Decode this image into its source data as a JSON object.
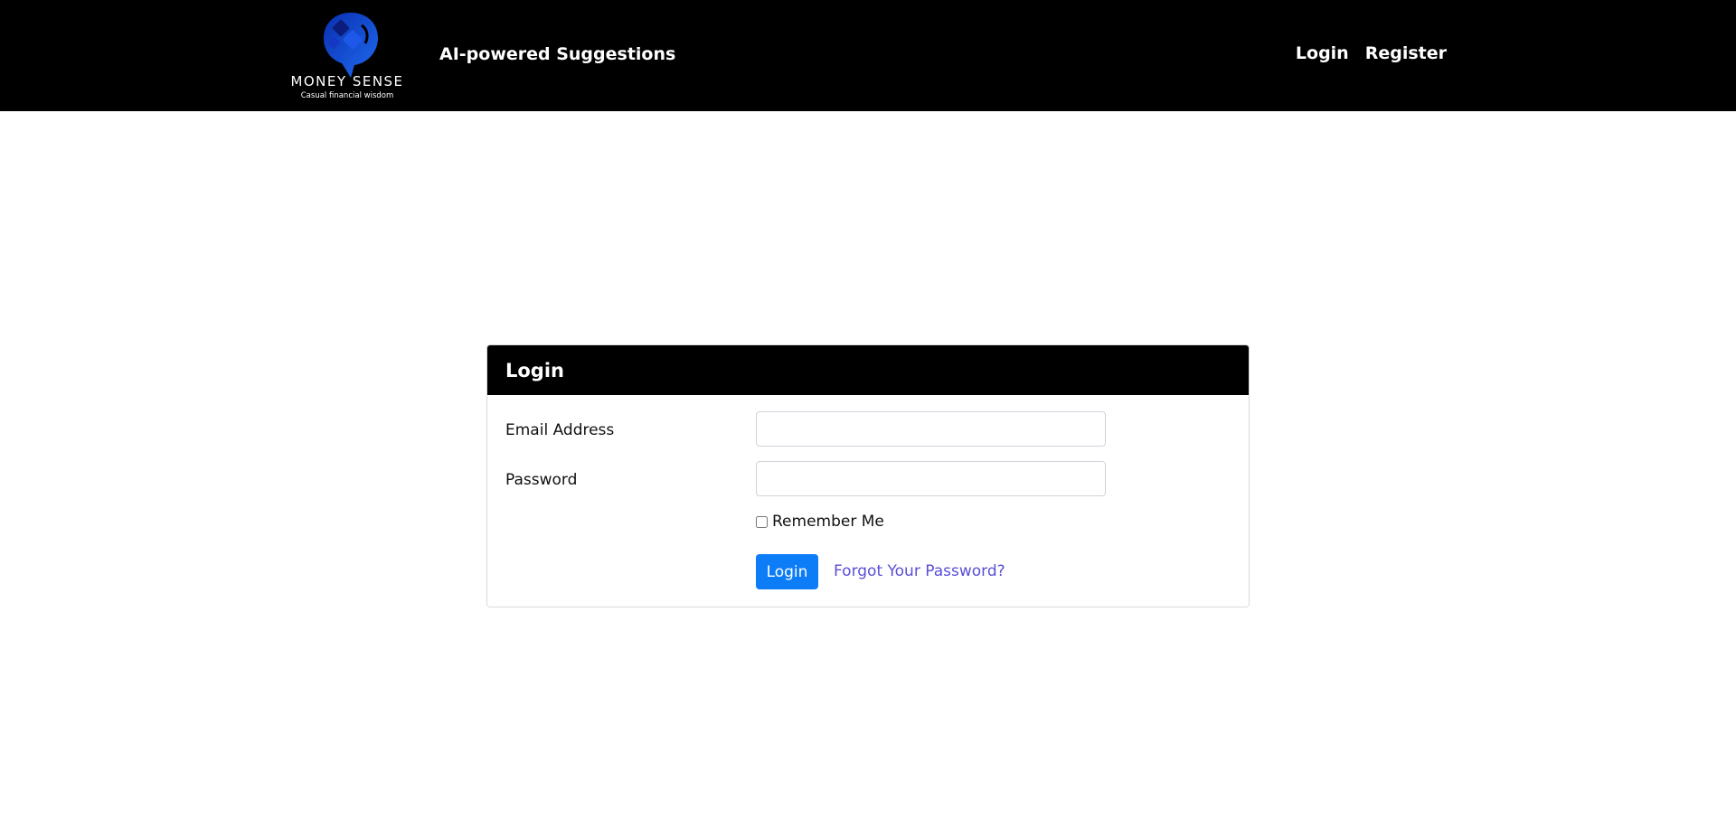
{
  "brand": {
    "name": "MONEY SENSE",
    "tagline": "Casual financial wisdom",
    "logo_icon": "money-sense-logo-icon"
  },
  "nav": {
    "title": "AI-powered Suggestions",
    "links": [
      {
        "label": "Login"
      },
      {
        "label": "Register"
      }
    ]
  },
  "login_card": {
    "title": "Login",
    "email_label": "Email Address",
    "email_value": "",
    "password_label": "Password",
    "password_value": "",
    "remember_label": "Remember Me",
    "remember_checked": false,
    "submit_label": "Login",
    "forgot_label": "Forgot Your Password?"
  },
  "colors": {
    "navbar_bg": "#000000",
    "primary_button": "#0d7cf7",
    "link": "#5a4fd6",
    "logo_blue": "#1a4fd8"
  }
}
